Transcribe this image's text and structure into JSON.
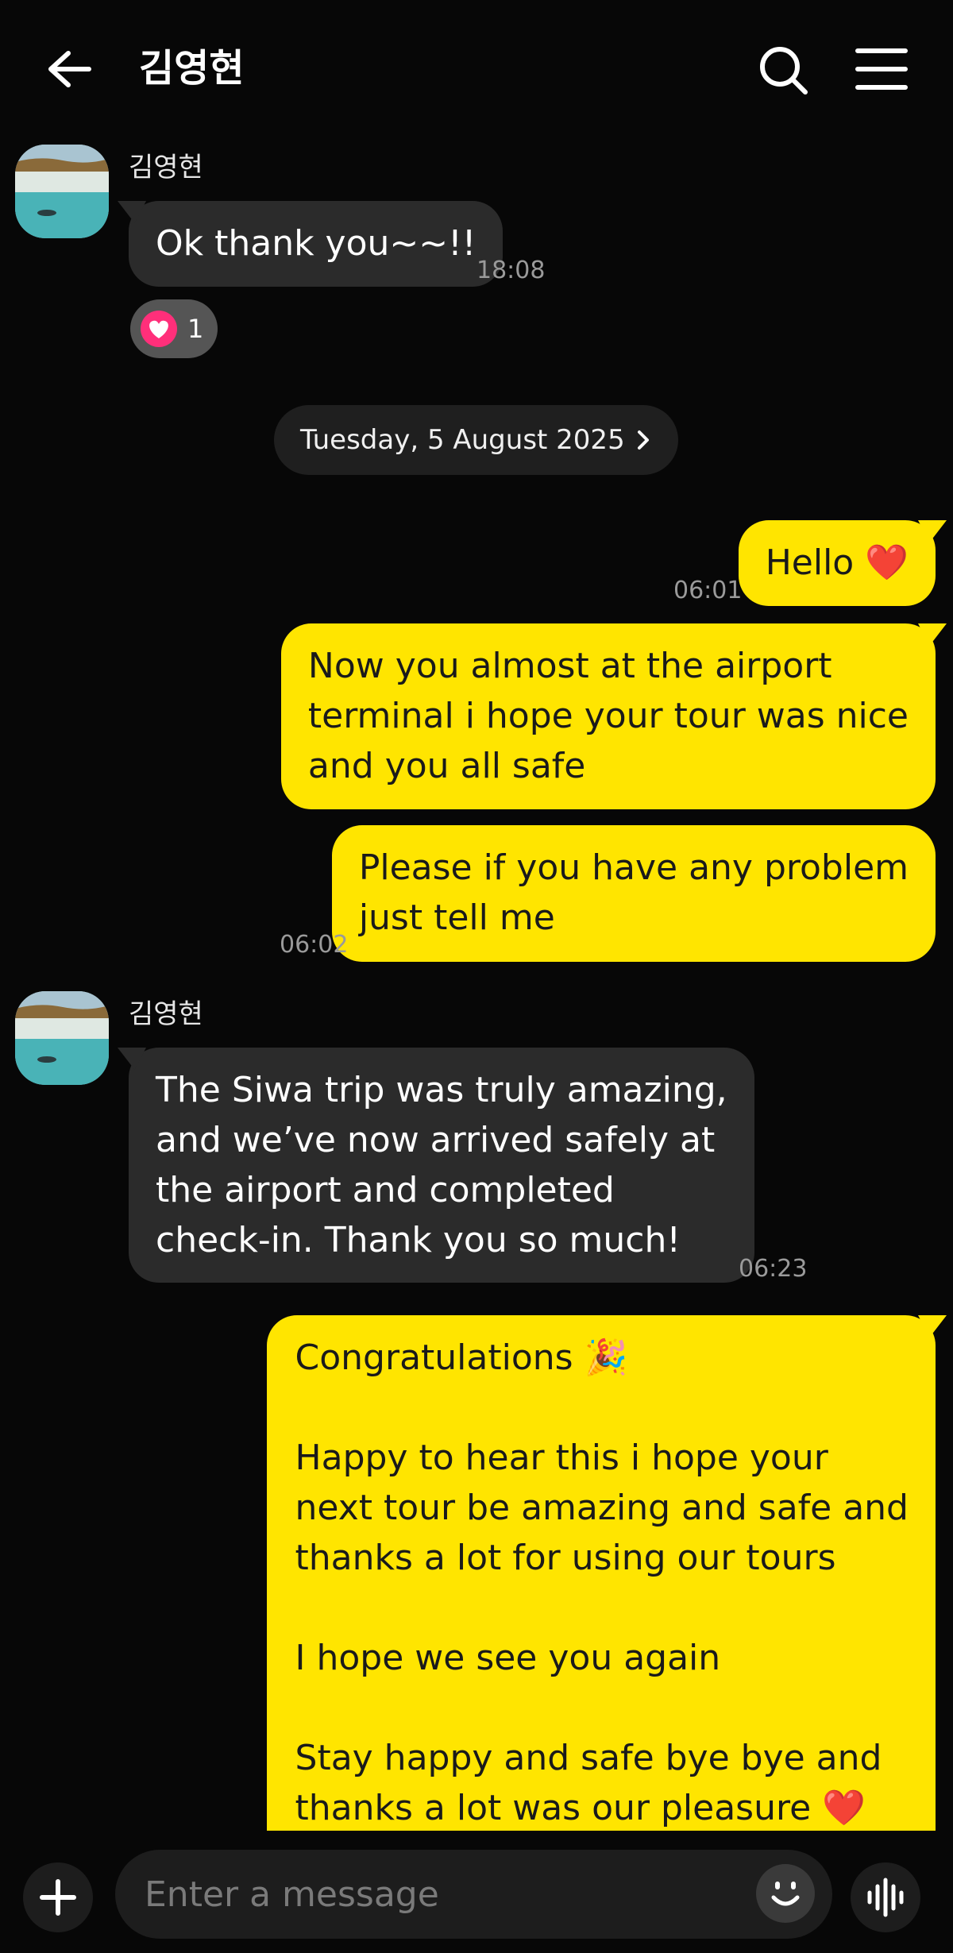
{
  "header": {
    "title": "김영현"
  },
  "messages": [
    {
      "sender": "김영현",
      "lines": [
        "Ok thank you~~!!"
      ],
      "time": "18:08",
      "reaction_count": "1"
    },
    {
      "date": "Tuesday, 5 August 2025"
    },
    {
      "lines": [
        "Hello ❤️"
      ],
      "time": "06:01"
    },
    {
      "lines": [
        "Now you almost at the airport",
        "terminal i hope your tour was nice",
        "and you all safe"
      ]
    },
    {
      "lines": [
        "Please if you have any problem",
        "just tell me"
      ],
      "time": "06:02"
    },
    {
      "sender": "김영현",
      "lines": [
        "The Siwa trip was truly amazing,",
        "and we’ve now arrived safely at",
        "the airport and completed",
        "check-in. Thank you so much!"
      ],
      "time": "06:23"
    },
    {
      "lines": [
        "Congratulations 🎉",
        "",
        "Happy to hear this i hope your",
        "next tour be amazing and safe and",
        "thanks a lot for using our tours",
        "",
        "I hope we see you again",
        "",
        "Stay happy and safe bye bye and",
        "thanks a lot was our pleasure ❤️"
      ]
    }
  ],
  "composer": {
    "placeholder": "Enter a message"
  },
  "colors": {
    "background": "#070707",
    "outgoing_bubble": "#ffe500",
    "incoming_bubble": "#2b2b2b",
    "reaction_heart": "#ff2f7a"
  },
  "icons": [
    "back-arrow-icon",
    "search-icon",
    "menu-icon",
    "heart-icon",
    "chevron-right-icon",
    "plus-icon",
    "emoji-icon",
    "voice-icon"
  ]
}
